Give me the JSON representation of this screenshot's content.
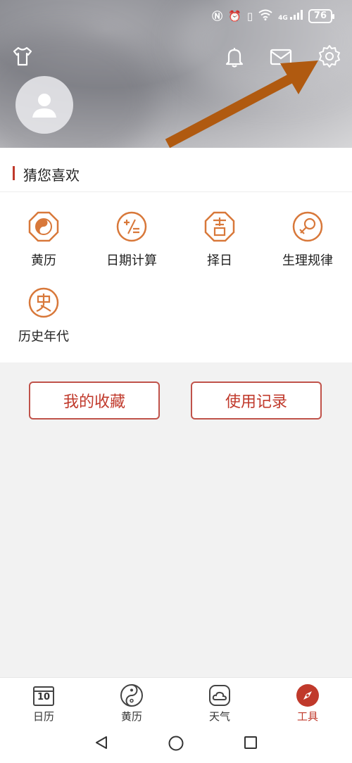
{
  "status_bar": {
    "battery": "76",
    "network": "4G"
  },
  "section": {
    "title": "猜您喜欢"
  },
  "tools": [
    {
      "label": "黄历",
      "icon": "yinyang-octagon-icon"
    },
    {
      "label": "日期计算",
      "icon": "calculator-icon"
    },
    {
      "label": "择日",
      "icon": "ji-character-icon"
    },
    {
      "label": "生理规律",
      "icon": "female-symbol-icon"
    },
    {
      "label": "历史年代",
      "icon": "shi-character-icon"
    }
  ],
  "buttons": {
    "favorites": "我的收藏",
    "history": "使用记录"
  },
  "tabbar": {
    "calendar_num": "10",
    "items": [
      {
        "label": "日历"
      },
      {
        "label": "黄历"
      },
      {
        "label": "天气"
      },
      {
        "label": "工具"
      }
    ]
  },
  "colors": {
    "accent": "#c0392b",
    "tool_icon": "#d8783a",
    "arrow": "#b05a10"
  }
}
